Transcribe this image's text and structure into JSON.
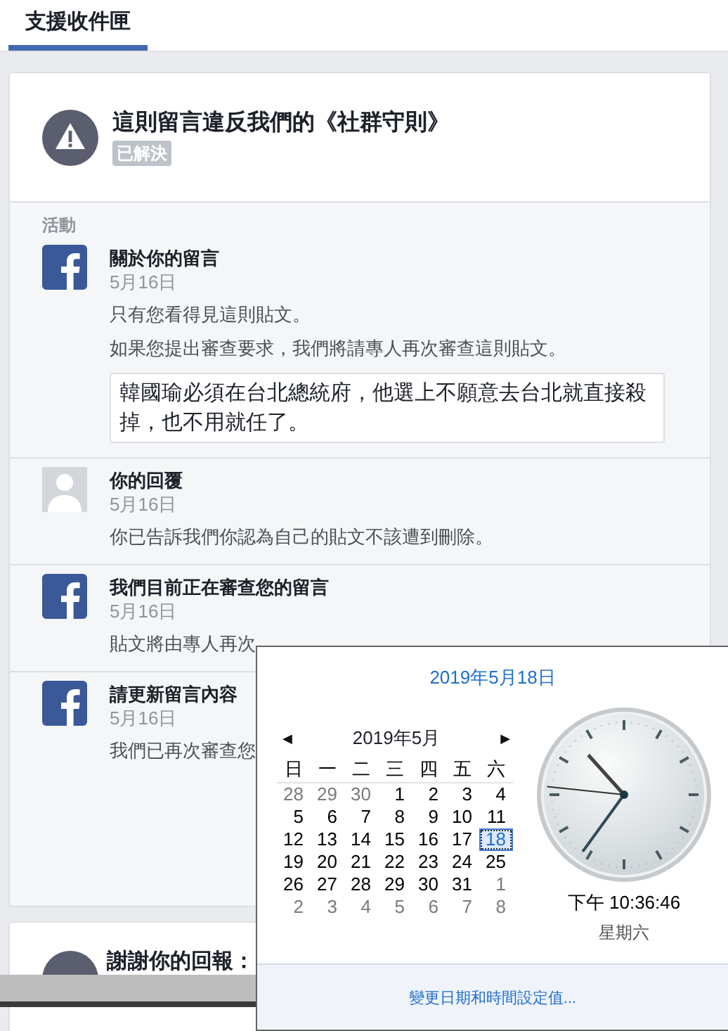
{
  "tab": {
    "label": "支援收件匣",
    "selected": true
  },
  "report": {
    "title": "這則留言違反我們的《社群守則》",
    "status": "已解決"
  },
  "activity": {
    "heading": "活動",
    "items": [
      {
        "kind": "facebook",
        "title": "關於你的留言",
        "date": "5月16日",
        "lines": [
          "只有您看得見這則貼文。",
          "如果您提出審查要求，我們將請專人再次審查這則貼文。"
        ],
        "quote": "韓國瑜必須在台北總統府，他選上不願意去台北就直接殺掉，也不用就任了。"
      },
      {
        "kind": "avatar",
        "title": "你的回覆",
        "date": "5月16日",
        "lines": [
          "你已告訴我們你認為自己的貼文不該遭到刪除。"
        ]
      },
      {
        "kind": "facebook",
        "title": "我們目前正在審查您的留言",
        "date": "5月16日",
        "lines": [
          "貼文將由專人再次"
        ]
      },
      {
        "kind": "facebook",
        "title": "請更新留言內容",
        "date": "5月16日",
        "lines": [
          "我們已再次審查您"
        ]
      }
    ]
  },
  "next_card": {
    "title": "謝謝你的回報："
  },
  "clock_popup": {
    "date_link": "2019年5月18日",
    "month": "2019年5月",
    "prev": "◀",
    "next": "▶",
    "weekdays": [
      "日",
      "一",
      "二",
      "三",
      "四",
      "五",
      "六"
    ],
    "weeks": [
      [
        {
          "day": "28",
          "muted": true,
          "selected": false
        },
        {
          "day": "29",
          "muted": true,
          "selected": false
        },
        {
          "day": "30",
          "muted": true,
          "selected": false
        },
        {
          "day": "1",
          "muted": false,
          "selected": false
        },
        {
          "day": "2",
          "muted": false,
          "selected": false
        },
        {
          "day": "3",
          "muted": false,
          "selected": false
        },
        {
          "day": "4",
          "muted": false,
          "selected": false
        }
      ],
      [
        {
          "day": "5",
          "muted": false,
          "selected": false
        },
        {
          "day": "6",
          "muted": false,
          "selected": false
        },
        {
          "day": "7",
          "muted": false,
          "selected": false
        },
        {
          "day": "8",
          "muted": false,
          "selected": false
        },
        {
          "day": "9",
          "muted": false,
          "selected": false
        },
        {
          "day": "10",
          "muted": false,
          "selected": false
        },
        {
          "day": "11",
          "muted": false,
          "selected": false
        }
      ],
      [
        {
          "day": "12",
          "muted": false,
          "selected": false
        },
        {
          "day": "13",
          "muted": false,
          "selected": false
        },
        {
          "day": "14",
          "muted": false,
          "selected": false
        },
        {
          "day": "15",
          "muted": false,
          "selected": false
        },
        {
          "day": "16",
          "muted": false,
          "selected": false
        },
        {
          "day": "17",
          "muted": false,
          "selected": false
        },
        {
          "day": "18",
          "muted": false,
          "selected": true
        }
      ],
      [
        {
          "day": "19",
          "muted": false,
          "selected": false
        },
        {
          "day": "20",
          "muted": false,
          "selected": false
        },
        {
          "day": "21",
          "muted": false,
          "selected": false
        },
        {
          "day": "22",
          "muted": false,
          "selected": false
        },
        {
          "day": "23",
          "muted": false,
          "selected": false
        },
        {
          "day": "24",
          "muted": false,
          "selected": false
        },
        {
          "day": "25",
          "muted": false,
          "selected": false
        }
      ],
      [
        {
          "day": "26",
          "muted": false,
          "selected": false
        },
        {
          "day": "27",
          "muted": false,
          "selected": false
        },
        {
          "day": "28",
          "muted": false,
          "selected": false
        },
        {
          "day": "29",
          "muted": false,
          "selected": false
        },
        {
          "day": "30",
          "muted": false,
          "selected": false
        },
        {
          "day": "31",
          "muted": false,
          "selected": false
        },
        {
          "day": "1",
          "muted": true,
          "selected": false
        }
      ],
      [
        {
          "day": "2",
          "muted": true,
          "selected": false
        },
        {
          "day": "3",
          "muted": true,
          "selected": false
        },
        {
          "day": "4",
          "muted": true,
          "selected": false
        },
        {
          "day": "5",
          "muted": true,
          "selected": false
        },
        {
          "day": "6",
          "muted": true,
          "selected": false
        },
        {
          "day": "7",
          "muted": true,
          "selected": false
        },
        {
          "day": "8",
          "muted": true,
          "selected": false
        }
      ]
    ],
    "time": "下午 10:36:46",
    "weekday": "星期六",
    "settings_link": "變更日期和時間設定值..."
  }
}
